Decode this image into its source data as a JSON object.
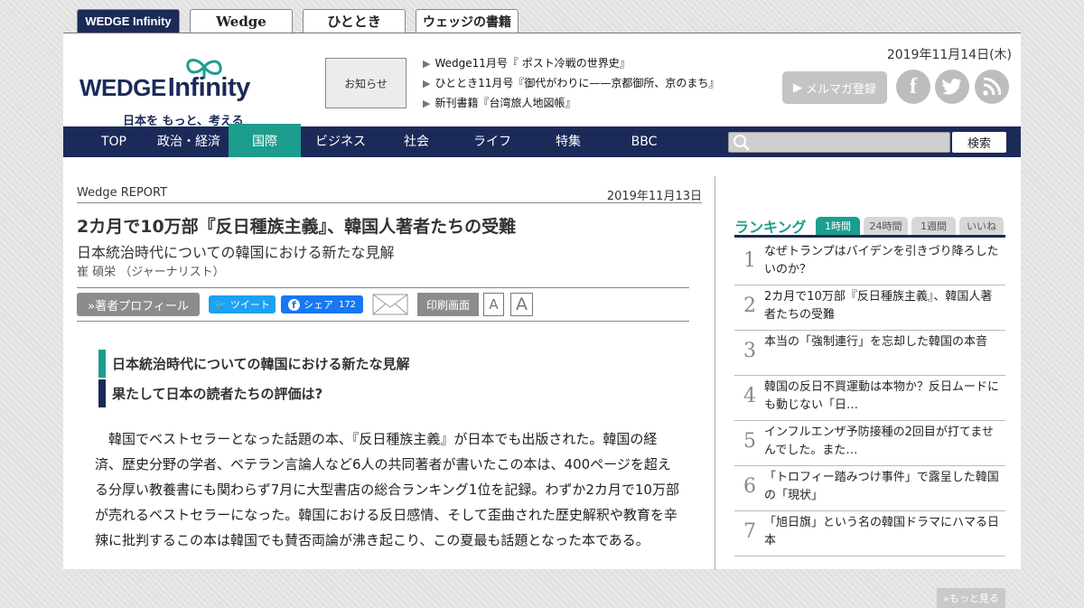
{
  "site_tabs": [
    {
      "label": "WEDGE Infinity"
    },
    {
      "label": "Wedge"
    },
    {
      "label": "ひととき"
    },
    {
      "label": "ウェッジの書籍"
    }
  ],
  "header": {
    "logo_text": "WEDGE",
    "logo_text_2": "Infinity",
    "tagline": "日本を もっと、考える",
    "notice_label": "お知らせ",
    "news": [
      "Wedge11月号『 ポスト冷戦の世界史』",
      "ひととき11月号『御代がわりに——京都御所、京のまち』",
      "新刊書籍『台湾旅人地図帳』"
    ],
    "date": "2019年11月14日(木)",
    "mail_label": "メルマガ登録",
    "social_icons": [
      "facebook-icon",
      "twitter-icon",
      "rss-icon"
    ]
  },
  "nav": {
    "items": [
      "TOP",
      "政治・経済",
      "国際",
      "ビジネス",
      "社会",
      "ライフ",
      "特集",
      "BBC"
    ],
    "active": "国際",
    "search_button": "検索"
  },
  "article": {
    "section": "Wedge REPORT",
    "date": "2019年11月13日",
    "title": "2カ月で10万部『反日種族主義』、韓国人著者たちの受難",
    "subtitle": "日本統治時代についての韓国における新たな見解",
    "author": "崔 碩栄 （ジャーナリスト）",
    "profile_button": "»著者プロフィール",
    "tweet_label": "ツイート",
    "share_label": "シェア",
    "share_count": "172",
    "print_label": "印刷画面",
    "font_small": "A",
    "font_large": "A",
    "lead": [
      "日本統治時代についての韓国における新たな見解",
      "果たして日本の読者たちの評価は?"
    ],
    "body": "　韓国でベストセラーとなった話題の本、『反日種族主義』が日本でも出版された。韓国の経済、歴史分野の学者、ベテラン言論人など6人の共同著者が書いたこの本は、400ページを超える分厚い教養書にも関わらず7月に大型書店の総合ランキング1位を記録。わずか2カ月で10万部が売れるベストセラーになった。韓国における反日感情、そして歪曲された歴史解釈や教育を辛辣に批判するこの本は韓国でも賛否両論が沸き起こり、この夏最も話題となった本である。"
  },
  "ranking": {
    "title": "ランキング",
    "tabs": [
      "1時間",
      "24時間",
      "1週間",
      "いいね"
    ],
    "active_tab": "1時間",
    "items": [
      {
        "num": "1",
        "text": "なぜトランプはバイデンを引きづり降ろしたいのか？"
      },
      {
        "num": "2",
        "text": "2カ月で10万部『反日種族主義』、韓国人著者たちの受難"
      },
      {
        "num": "3",
        "text": "本当の「強制連行」を忘却した韓国の本音"
      },
      {
        "num": "4",
        "text": "韓国の反日不買運動は本物か？反日ムードにも動じない「日…"
      },
      {
        "num": "5",
        "text": "インフルエンザ予防接種の2回目が打てませんでした。また…"
      },
      {
        "num": "6",
        "text": "「トロフィー踏みつけ事件」で露呈した韓国の「現状」"
      },
      {
        "num": "7",
        "text": "「旭日旗」という名の韓国ドラマにハマる日本"
      }
    ],
    "more_label": "»もっと見る"
  },
  "colors": {
    "navy": "#1b2a58",
    "teal": "#1d9d8d",
    "twitter": "#1da1f2",
    "facebook": "#1877f2"
  }
}
